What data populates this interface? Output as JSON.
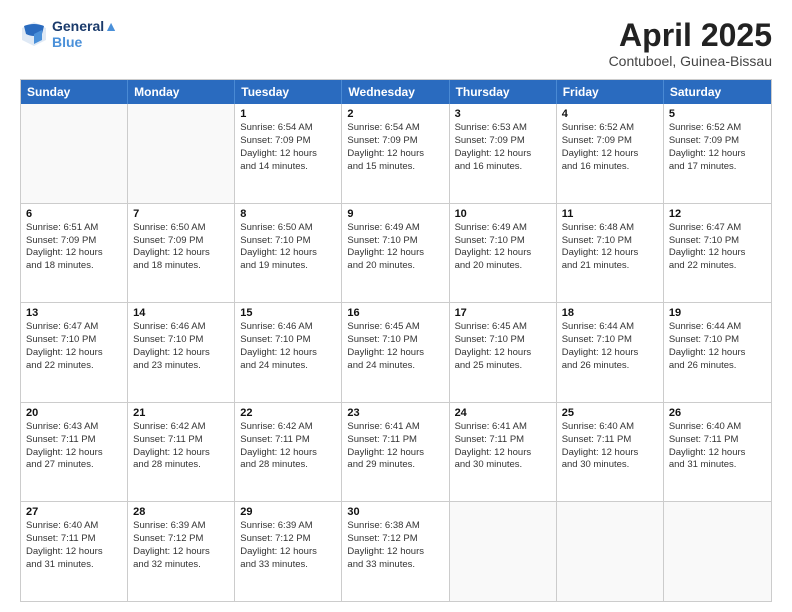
{
  "header": {
    "logo_line1": "General",
    "logo_line2": "Blue",
    "month_title": "April 2025",
    "subtitle": "Contuboel, Guinea-Bissau"
  },
  "weekdays": [
    "Sunday",
    "Monday",
    "Tuesday",
    "Wednesday",
    "Thursday",
    "Friday",
    "Saturday"
  ],
  "rows": [
    [
      {
        "day": "",
        "lines": [],
        "empty": true
      },
      {
        "day": "",
        "lines": [],
        "empty": true
      },
      {
        "day": "1",
        "lines": [
          "Sunrise: 6:54 AM",
          "Sunset: 7:09 PM",
          "Daylight: 12 hours",
          "and 14 minutes."
        ]
      },
      {
        "day": "2",
        "lines": [
          "Sunrise: 6:54 AM",
          "Sunset: 7:09 PM",
          "Daylight: 12 hours",
          "and 15 minutes."
        ]
      },
      {
        "day": "3",
        "lines": [
          "Sunrise: 6:53 AM",
          "Sunset: 7:09 PM",
          "Daylight: 12 hours",
          "and 16 minutes."
        ]
      },
      {
        "day": "4",
        "lines": [
          "Sunrise: 6:52 AM",
          "Sunset: 7:09 PM",
          "Daylight: 12 hours",
          "and 16 minutes."
        ]
      },
      {
        "day": "5",
        "lines": [
          "Sunrise: 6:52 AM",
          "Sunset: 7:09 PM",
          "Daylight: 12 hours",
          "and 17 minutes."
        ]
      }
    ],
    [
      {
        "day": "6",
        "lines": [
          "Sunrise: 6:51 AM",
          "Sunset: 7:09 PM",
          "Daylight: 12 hours",
          "and 18 minutes."
        ]
      },
      {
        "day": "7",
        "lines": [
          "Sunrise: 6:50 AM",
          "Sunset: 7:09 PM",
          "Daylight: 12 hours",
          "and 18 minutes."
        ]
      },
      {
        "day": "8",
        "lines": [
          "Sunrise: 6:50 AM",
          "Sunset: 7:10 PM",
          "Daylight: 12 hours",
          "and 19 minutes."
        ]
      },
      {
        "day": "9",
        "lines": [
          "Sunrise: 6:49 AM",
          "Sunset: 7:10 PM",
          "Daylight: 12 hours",
          "and 20 minutes."
        ]
      },
      {
        "day": "10",
        "lines": [
          "Sunrise: 6:49 AM",
          "Sunset: 7:10 PM",
          "Daylight: 12 hours",
          "and 20 minutes."
        ]
      },
      {
        "day": "11",
        "lines": [
          "Sunrise: 6:48 AM",
          "Sunset: 7:10 PM",
          "Daylight: 12 hours",
          "and 21 minutes."
        ]
      },
      {
        "day": "12",
        "lines": [
          "Sunrise: 6:47 AM",
          "Sunset: 7:10 PM",
          "Daylight: 12 hours",
          "and 22 minutes."
        ]
      }
    ],
    [
      {
        "day": "13",
        "lines": [
          "Sunrise: 6:47 AM",
          "Sunset: 7:10 PM",
          "Daylight: 12 hours",
          "and 22 minutes."
        ]
      },
      {
        "day": "14",
        "lines": [
          "Sunrise: 6:46 AM",
          "Sunset: 7:10 PM",
          "Daylight: 12 hours",
          "and 23 minutes."
        ]
      },
      {
        "day": "15",
        "lines": [
          "Sunrise: 6:46 AM",
          "Sunset: 7:10 PM",
          "Daylight: 12 hours",
          "and 24 minutes."
        ]
      },
      {
        "day": "16",
        "lines": [
          "Sunrise: 6:45 AM",
          "Sunset: 7:10 PM",
          "Daylight: 12 hours",
          "and 24 minutes."
        ]
      },
      {
        "day": "17",
        "lines": [
          "Sunrise: 6:45 AM",
          "Sunset: 7:10 PM",
          "Daylight: 12 hours",
          "and 25 minutes."
        ]
      },
      {
        "day": "18",
        "lines": [
          "Sunrise: 6:44 AM",
          "Sunset: 7:10 PM",
          "Daylight: 12 hours",
          "and 26 minutes."
        ]
      },
      {
        "day": "19",
        "lines": [
          "Sunrise: 6:44 AM",
          "Sunset: 7:10 PM",
          "Daylight: 12 hours",
          "and 26 minutes."
        ]
      }
    ],
    [
      {
        "day": "20",
        "lines": [
          "Sunrise: 6:43 AM",
          "Sunset: 7:11 PM",
          "Daylight: 12 hours",
          "and 27 minutes."
        ]
      },
      {
        "day": "21",
        "lines": [
          "Sunrise: 6:42 AM",
          "Sunset: 7:11 PM",
          "Daylight: 12 hours",
          "and 28 minutes."
        ]
      },
      {
        "day": "22",
        "lines": [
          "Sunrise: 6:42 AM",
          "Sunset: 7:11 PM",
          "Daylight: 12 hours",
          "and 28 minutes."
        ]
      },
      {
        "day": "23",
        "lines": [
          "Sunrise: 6:41 AM",
          "Sunset: 7:11 PM",
          "Daylight: 12 hours",
          "and 29 minutes."
        ]
      },
      {
        "day": "24",
        "lines": [
          "Sunrise: 6:41 AM",
          "Sunset: 7:11 PM",
          "Daylight: 12 hours",
          "and 30 minutes."
        ]
      },
      {
        "day": "25",
        "lines": [
          "Sunrise: 6:40 AM",
          "Sunset: 7:11 PM",
          "Daylight: 12 hours",
          "and 30 minutes."
        ]
      },
      {
        "day": "26",
        "lines": [
          "Sunrise: 6:40 AM",
          "Sunset: 7:11 PM",
          "Daylight: 12 hours",
          "and 31 minutes."
        ]
      }
    ],
    [
      {
        "day": "27",
        "lines": [
          "Sunrise: 6:40 AM",
          "Sunset: 7:11 PM",
          "Daylight: 12 hours",
          "and 31 minutes."
        ]
      },
      {
        "day": "28",
        "lines": [
          "Sunrise: 6:39 AM",
          "Sunset: 7:12 PM",
          "Daylight: 12 hours",
          "and 32 minutes."
        ]
      },
      {
        "day": "29",
        "lines": [
          "Sunrise: 6:39 AM",
          "Sunset: 7:12 PM",
          "Daylight: 12 hours",
          "and 33 minutes."
        ]
      },
      {
        "day": "30",
        "lines": [
          "Sunrise: 6:38 AM",
          "Sunset: 7:12 PM",
          "Daylight: 12 hours",
          "and 33 minutes."
        ]
      },
      {
        "day": "",
        "lines": [],
        "empty": true
      },
      {
        "day": "",
        "lines": [],
        "empty": true
      },
      {
        "day": "",
        "lines": [],
        "empty": true
      }
    ]
  ]
}
